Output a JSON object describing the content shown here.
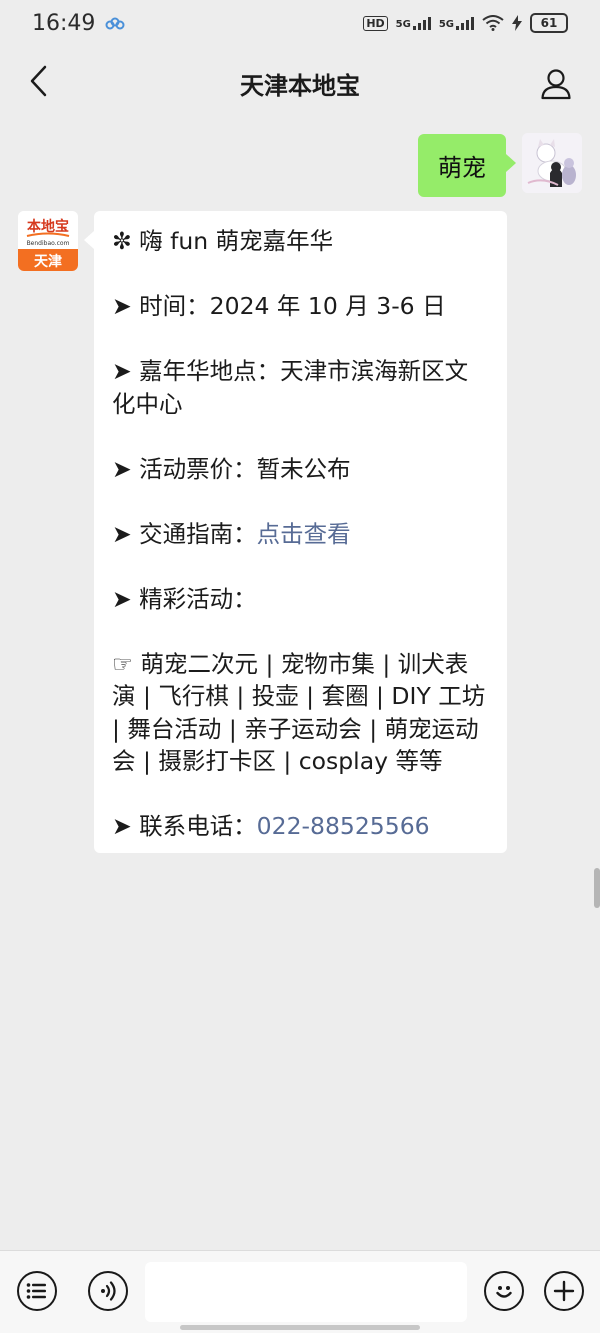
{
  "statusbar": {
    "time": "16:49",
    "network_a": "HD",
    "network_b": "5G",
    "network_c": "5G",
    "battery": "61"
  },
  "header": {
    "title": "天津本地宝",
    "back_icon": "chevron-left-icon",
    "profile_icon": "person-icon"
  },
  "messages": {
    "outgoing": {
      "text": "萌宠"
    },
    "bot_avatar": {
      "logo_top": "本地宝",
      "logo_url": "Bendibao.com",
      "logo_bottom": "天津"
    },
    "incoming": {
      "title": "✼ 嗨 fun 萌宠嘉年华",
      "time": "➤ 时间：2024 年 10 月 3-6 日",
      "place": "➤ 嘉年华地点：天津市滨海新区文化中心",
      "price": "➤ 活动票价：暂未公布",
      "traffic_label": "➤ 交通指南：",
      "traffic_link": "点击查看",
      "activities_label": "➤ 精彩活动：",
      "activities": "☞ 萌宠二次元 | 宠物市集 | 训犬表演 | 飞行棋 | 投壶 | 套圈 | DIY 工坊 | 舞台活动 | 亲子运动会 | 萌宠运动会 | 摄影打卡区 | cosplay 等等",
      "phone_label": "➤ 联系电话：",
      "phone": "022-88525566"
    }
  },
  "input_bar": {
    "menu_icon": "list-icon",
    "voice_icon": "voice-icon",
    "emoji_icon": "smile-icon",
    "add_icon": "plus-icon"
  },
  "colors": {
    "background": "#ededed",
    "outgoing_bubble": "#95ec69",
    "link": "#576b95",
    "brand_orange": "#f36f21"
  }
}
